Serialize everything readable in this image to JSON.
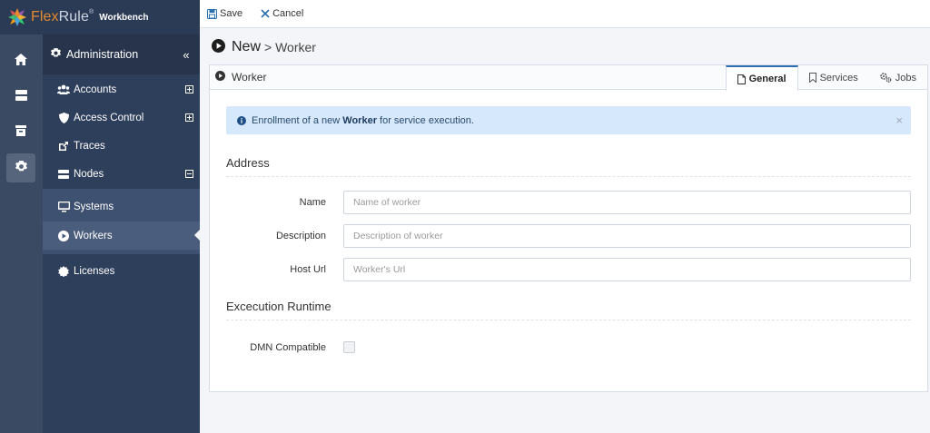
{
  "brand": {
    "name_part1": "Flex",
    "name_part2": "Rule",
    "registered": "®",
    "subtitle": "Workbench"
  },
  "colors": {
    "accent": "#2a6fb0",
    "sidebar_bg": "#2e3f5c",
    "alert_bg": "#d6e8fb",
    "brand_orange": "#e58a2e"
  },
  "rail": {
    "items": [
      {
        "name": "home",
        "icon": "home-icon"
      },
      {
        "name": "servers",
        "icon": "server-icon"
      },
      {
        "name": "archive",
        "icon": "archive-icon"
      },
      {
        "name": "settings",
        "icon": "gear-icon",
        "active": true
      }
    ]
  },
  "sidebar": {
    "header": "Administration",
    "collapse_glyph": "«",
    "items": [
      {
        "label": "Accounts",
        "icon": "users-icon",
        "toggle": "+"
      },
      {
        "label": "Access Control",
        "icon": "shield-icon",
        "toggle": "+"
      },
      {
        "label": "Traces",
        "icon": "external-link-icon"
      },
      {
        "label": "Nodes",
        "icon": "server-icon",
        "toggle": "−"
      },
      {
        "label": "Systems",
        "icon": "monitor-icon"
      },
      {
        "label": "Workers",
        "icon": "play-circle-icon",
        "selected": true
      },
      {
        "label": "Licenses",
        "icon": "certificate-icon"
      }
    ]
  },
  "toolbar": {
    "save_label": "Save",
    "cancel_label": "Cancel"
  },
  "page": {
    "title": "New",
    "crumb": "> Worker"
  },
  "panel": {
    "title": "Worker",
    "tabs": [
      {
        "label": "General",
        "icon": "file-icon",
        "active": true
      },
      {
        "label": "Services",
        "icon": "bookmark-icon"
      },
      {
        "label": "Jobs",
        "icon": "cogs-icon"
      }
    ]
  },
  "alert": {
    "text_before": "Enrollment of a new ",
    "text_bold": "Worker",
    "text_after": " for service execution.",
    "close_glyph": "×"
  },
  "address": {
    "title": "Address",
    "fields": [
      {
        "label": "Name",
        "placeholder": "Name of worker",
        "value": ""
      },
      {
        "label": "Description",
        "placeholder": "Description of worker",
        "value": ""
      },
      {
        "label": "Host Url",
        "placeholder": "Worker's Url",
        "value": ""
      }
    ]
  },
  "runtime": {
    "title": "Excecution Runtime",
    "dmn_label": "DMN Compatible",
    "dmn_checked": false
  }
}
